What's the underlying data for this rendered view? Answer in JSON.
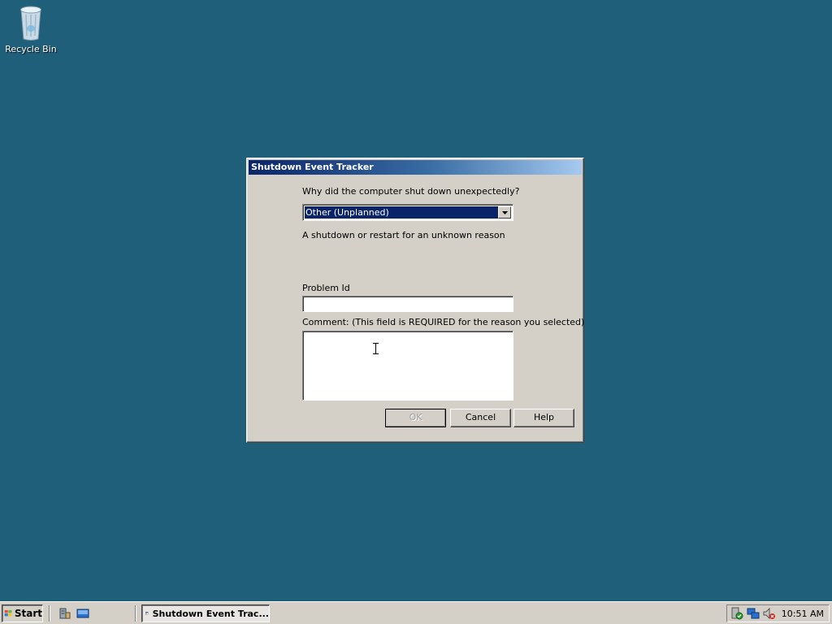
{
  "desktop": {
    "recycle_bin_label": "Recycle Bin"
  },
  "dialog": {
    "title": "Shutdown Event Tracker",
    "question": "Why did the computer shut down unexpectedly?",
    "reason_selected": "Other (Unplanned)",
    "reason_description": "A shutdown or restart for an unknown reason",
    "problem_id_label": "Problem Id",
    "problem_id_value": "",
    "comment_label": "Comment: (This field is REQUIRED for the reason you selected)",
    "comment_value": "",
    "ok_label": "OK",
    "cancel_label": "Cancel",
    "help_label": "Help"
  },
  "taskbar": {
    "start_label": "Start",
    "task_label": "Shutdown Event Trac...",
    "clock": "10:51 AM"
  },
  "colors": {
    "desktop": "#1f5f7a",
    "title_start": "#0a246a",
    "title_end": "#a6caf0",
    "selection": "#0a246a",
    "face": "#d4d0c8"
  }
}
